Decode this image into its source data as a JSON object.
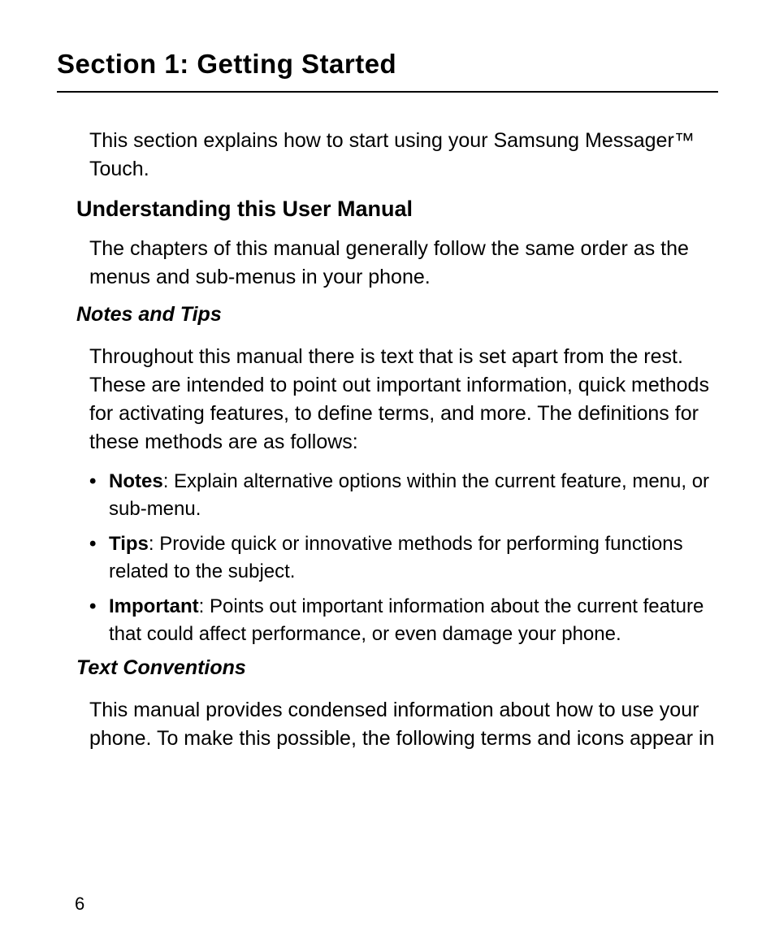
{
  "section": {
    "title": "Section 1: Getting Started",
    "intro": "This section explains how to start using your Samsung Messager™ Touch."
  },
  "understanding": {
    "heading": "Understanding this User Manual",
    "body": "The chapters of this manual generally follow the same order as the menus and sub-menus in your phone."
  },
  "notesTips": {
    "heading": "Notes and Tips",
    "intro": "Throughout this manual there is text that is set apart from the rest. These are intended to point out important information, quick methods for activating features, to define terms, and more. The definitions for these methods are as follows:",
    "items": {
      "notes": {
        "label": "Notes",
        "text": ": Explain alternative options within the current feature, menu, or sub-menu."
      },
      "tips": {
        "label": "Tips",
        "text": ": Provide quick or innovative methods for performing functions related to the subject."
      },
      "important": {
        "label": "Important",
        "text": ": Points out important information about the current feature that could affect performance, or even damage your phone."
      }
    }
  },
  "textConventions": {
    "heading": "Text Conventions",
    "body": "This manual provides condensed information about how to use your phone. To make this possible, the following terms and icons appear in"
  },
  "pageNumber": "6"
}
